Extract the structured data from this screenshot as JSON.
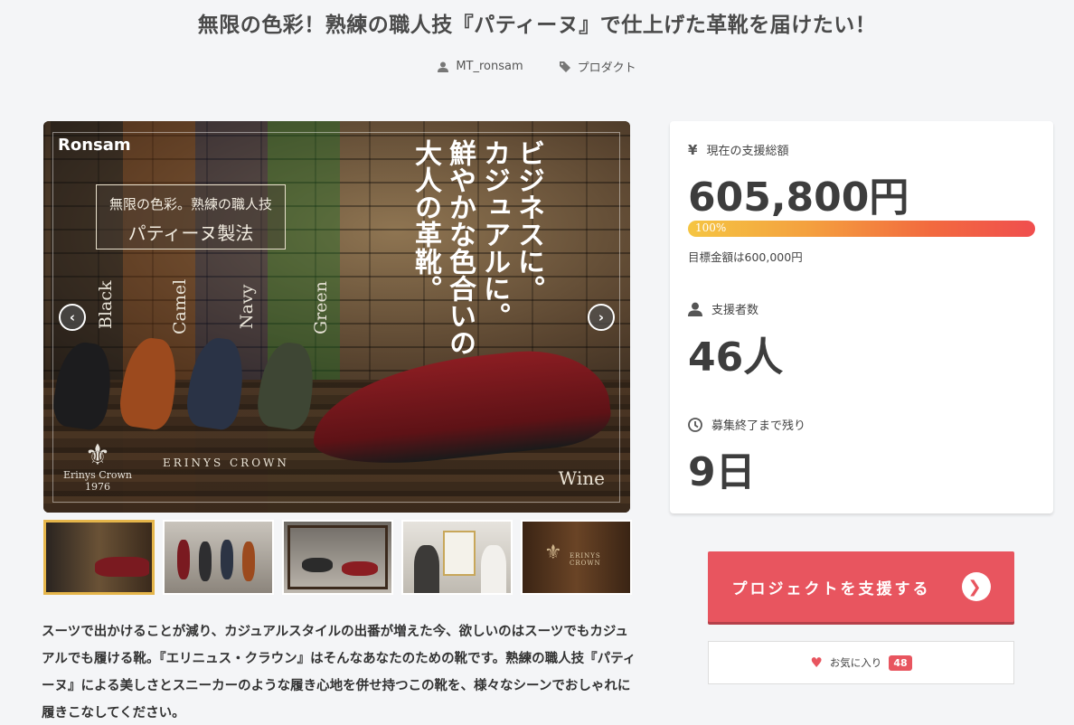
{
  "title": "無限の色彩！熟練の職人技『パティーヌ』で仕上げた革靴を届けたい！",
  "meta": {
    "author": "MT_ronsam",
    "category": "プロダクト"
  },
  "hero": {
    "brand": "Ronsam",
    "patina_line1": "無限の色彩。熟練の職人技",
    "patina_line2": "パティーヌ製法",
    "colors": [
      "Black",
      "Camel",
      "Navy",
      "Green"
    ],
    "copy_lines": [
      "ビジネスに。",
      "カジュアルに。",
      "鮮やかな色合いの",
      "大人の革靴。"
    ],
    "featured_color": "Wine",
    "crest_text": "Erinys Crown",
    "crest_year": "1976",
    "erinys_label": "ERINYS CROWN"
  },
  "description": "スーツで出かけることが減り、カジュアルスタイルの出番が増えた今、欲しいのはスーツでもカジュアルでも履ける靴。『エリニュス・クラウン』はそんなあなたのための靴です。熟練の職人技『パティーヌ』による美しさとスニーカーのような履き心地を併せ持つこの靴を、様々なシーンでおしゃれに履きこなしてください。",
  "stats": {
    "total_label": "現在の支援総額",
    "total_value": "605,800円",
    "progress_percent": 100,
    "progress_text": "100%",
    "goal_text": "目標金額は600,000円",
    "supporters_label": "支援者数",
    "supporters_value": "46人",
    "remaining_label": "募集終了まで残り",
    "remaining_value": "9日"
  },
  "actions": {
    "support_label": "プロジェクトを支援する",
    "favorite_label": "お気に入り",
    "favorite_count": "48"
  },
  "colors": {
    "accent": "#e8555f",
    "gold": "#e5b54a"
  }
}
